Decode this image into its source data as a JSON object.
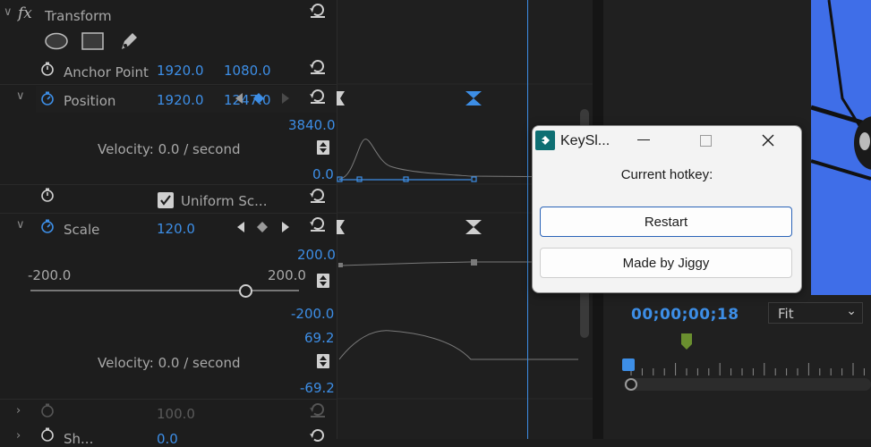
{
  "effects": {
    "fx_symbol": "fx",
    "title": "Transform",
    "anchor": {
      "label": "Anchor Point",
      "x": "1920.0",
      "y": "1080.0"
    },
    "position": {
      "label": "Position",
      "x": "1920.0",
      "y": "1247.0",
      "graph_max": "3840.0",
      "graph_min": "0.0",
      "velocity": "Velocity: 0.0 / second"
    },
    "uniform": {
      "label": "Uniform Sc..."
    },
    "scale": {
      "label": "Scale",
      "value": "120.0",
      "graph_max": "200.0",
      "graph_min": "-200.0",
      "slider_min": "-200.0",
      "slider_max": "200.0",
      "slider_value": 120,
      "vel_max": "69.2",
      "vel_min": "-69.2",
      "velocity": "Velocity: 0.0 / second"
    },
    "rotation": {
      "value": "100.0"
    },
    "next": {
      "label": "Sh...",
      "value": "0.0"
    }
  },
  "program": {
    "timecode": "00;00;00;18",
    "fit_label": "Fit"
  },
  "dialog": {
    "title": "KeySl...",
    "hotkey_label": "Current hotkey:",
    "restart_label": "Restart",
    "credit_label": "Made by Jiggy"
  },
  "colors": {
    "accent": "#3d8ee6",
    "bg": "#1d1d1d",
    "monitor_blue": "#3f6ee8"
  }
}
